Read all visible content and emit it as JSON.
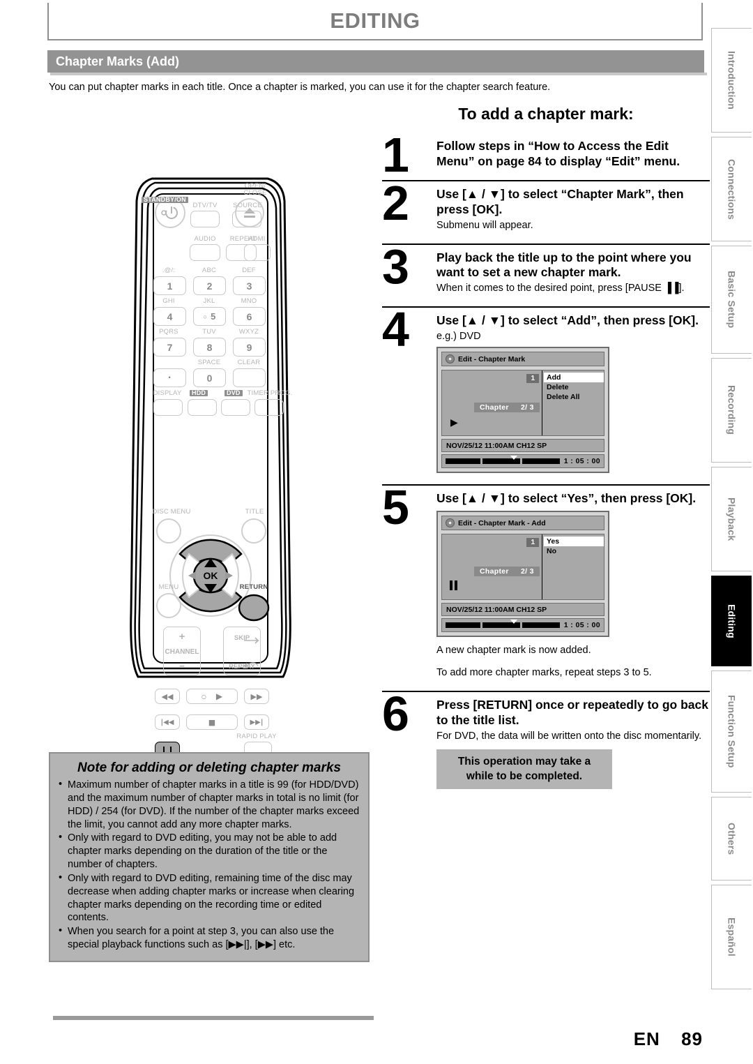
{
  "header": {
    "chapter_title": "EDITING",
    "section_title": "Chapter Marks (Add)",
    "intro": "You can put chapter marks in each title. Once a chapter is marked, you can use it for the chapter search feature."
  },
  "sidebar": {
    "tabs": [
      {
        "label": "Introduction",
        "active": false
      },
      {
        "label": "Connections",
        "active": false
      },
      {
        "label": "Basic Setup",
        "active": false
      },
      {
        "label": "Recording",
        "active": false
      },
      {
        "label": "Playback",
        "active": false
      },
      {
        "label": "Editing",
        "active": true
      },
      {
        "label": "Function Setup",
        "active": false
      },
      {
        "label": "Others",
        "active": false
      },
      {
        "label": "Español",
        "active": false
      }
    ]
  },
  "procedure": {
    "title": "To add a chapter mark:",
    "steps": [
      {
        "number": "1",
        "heading": "Follow steps in “How to Access the Edit Menu” on page 84 to display “Edit” menu.",
        "sub": ""
      },
      {
        "number": "2",
        "heading": "Use [▲ / ▼] to select “Chapter Mark”, then press [OK].",
        "sub": "Submenu will appear."
      },
      {
        "number": "3",
        "heading": "Play back the title up to the point where you want to set a new chapter mark.",
        "sub": "When it comes to the desired point, press [PAUSE ▐▐]."
      },
      {
        "number": "4",
        "heading": "Use [▲ / ▼] to select “Add”, then press [OK].",
        "sub": "e.g.) DVD"
      },
      {
        "number": "5",
        "heading": "Use [▲ / ▼] to select “Yes”, then press [OK].",
        "sub": ""
      },
      {
        "number": "6",
        "heading": "Press [RETURN] once or repeatedly to go back to the title list.",
        "sub": "For DVD, the data will be written onto the disc momentarily."
      }
    ],
    "after_step5_note_1": "A new chapter mark is now added.",
    "after_step5_note_2": "To add more chapter marks, repeat steps 3 to 5.",
    "callout": "This operation may take a while to be completed."
  },
  "osd_step4": {
    "title": "Edit - Chapter Mark",
    "chapter_number": "1",
    "chapter_label": "Chapter",
    "chapter_counter": "2/ 3",
    "play_state": "play",
    "menu": [
      {
        "label": "Add",
        "selected": true
      },
      {
        "label": "Delete",
        "selected": false
      },
      {
        "label": "Delete All",
        "selected": false
      }
    ],
    "info": "NOV/25/12 11:00AM CH12 SP",
    "time": "1 : 05 : 00"
  },
  "osd_step5": {
    "title": "Edit - Chapter Mark - Add",
    "chapter_number": "1",
    "chapter_label": "Chapter",
    "chapter_counter": "2/ 3",
    "play_state": "pause",
    "menu": [
      {
        "label": "Yes",
        "selected": true
      },
      {
        "label": "No",
        "selected": false
      }
    ],
    "info": "NOV/25/12 11:00AM CH12 SP",
    "time": "1 : 05 : 00"
  },
  "notebox": {
    "title": "Note for adding or deleting chapter marks",
    "items": [
      "Maximum number of chapter marks in a title is 99 (for HDD/DVD) and the maximum number of chapter marks in total is no limit (for HDD) / 254 (for DVD). If the number of the chapter marks exceed the limit, you cannot add any more chapter marks.",
      "Only with regard to DVD editing, you may not be able to add chapter marks depending on the duration of the title or the number of chapters.",
      "Only with regard to DVD editing, remaining time of the disc may decrease when adding chapter marks or increase when clearing chapter marks depending on the recording time or edited contents.",
      "When you search for a point at step 3, you can also use the special playback functions such as [▶▶|], [▶▶] etc."
    ]
  },
  "remote": {
    "labels": {
      "standby": "STANDBY/ON",
      "dtvtv": "DTV/TV",
      "source": "SOURCE",
      "open_close": "OPEN/\nCLOSE",
      "audio": "AUDIO",
      "repeat": "REPEAT",
      "hdmi": "HDMI",
      "key1_alt": ".@/:",
      "key2_alt": "ABC",
      "key3_alt": "DEF",
      "key4_alt": "GHI",
      "key5_alt": "JKL",
      "key6_alt": "MNO",
      "key7_alt": "PQRS",
      "key8_alt": "TUV",
      "key9_alt": "WXYZ",
      "key0_alt": "SPACE",
      "clear": "CLEAR",
      "display": "DISPLAY",
      "hdd": "HDD",
      "dvd": "DVD",
      "timer_prog": "TIMER PROG.",
      "disc_menu": "DISC MENU",
      "title": "TITLE",
      "menu": "MENU",
      "return": "RETURN",
      "ok": "OK",
      "channel": "CHANNEL",
      "channel_plus": "+",
      "channel_minus": "−",
      "skip": "SKIP",
      "replay": "REPLAY",
      "rapid_play": "RAPID PLAY",
      "num1": "1",
      "num2": "2",
      "num3": "3",
      "num4": "4",
      "num5": "5",
      "num6": "6",
      "num7": "7",
      "num8": "8",
      "num9": "9",
      "num0": "0",
      "dot": "·"
    }
  },
  "footer": {
    "lang": "EN",
    "page": "89"
  }
}
